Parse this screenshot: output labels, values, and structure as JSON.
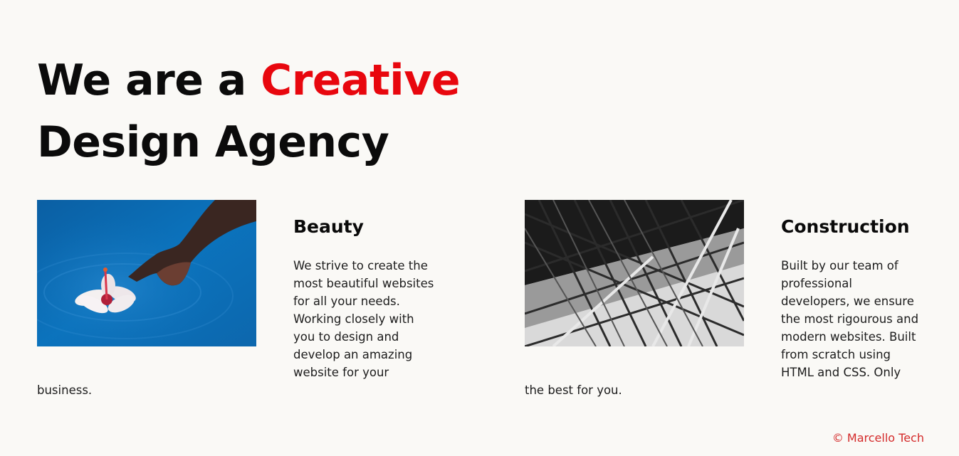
{
  "hero": {
    "line1_prefix": "We are a ",
    "line1_accent": "Creative",
    "line2": "Design Agency"
  },
  "cards": [
    {
      "title": "Beauty",
      "text": "We strive to create the most beautiful websites for all your needs. Working closely with you to design and develop an amazing website for your business.",
      "image_icon": "hand-flower-water-photo"
    },
    {
      "title": "Construction",
      "text": "Built by our team of professional developers, we ensure the most rigourous and modern websites. Built from scratch using HTML and CSS. Only the best for you.",
      "image_icon": "steel-structure-photo"
    }
  ],
  "footer": {
    "copyright": "© Marcello Tech"
  },
  "colors": {
    "accent": "#e8070e",
    "background": "#faf9f6",
    "footer_text": "#d42a2a"
  }
}
